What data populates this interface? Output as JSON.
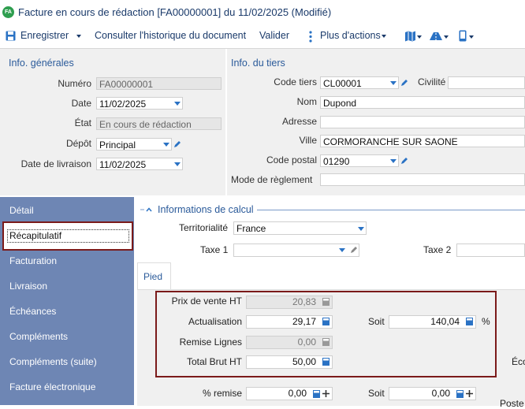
{
  "window": {
    "badge": "FA",
    "title": "Facture en cours de rédaction [FA00000001] du 11/02/2025 (Modifié)"
  },
  "toolbar": {
    "save_label": "Enregistrer",
    "history_label": "Consulter l'historique du document",
    "validate_label": "Valider",
    "more_actions_label": "Plus d'actions"
  },
  "general": {
    "section_title": "Info. générales",
    "numero_label": "Numéro",
    "numero_value": "FA00000001",
    "date_label": "Date",
    "date_value": "11/02/2025",
    "etat_label": "État",
    "etat_value": "En cours de rédaction",
    "depot_label": "Dépôt",
    "depot_value": "Principal",
    "livraison_label": "Date de livraison",
    "livraison_value": "11/02/2025"
  },
  "tiers": {
    "section_title": "Info. du tiers",
    "code_label": "Code tiers",
    "code_value": "CL00001",
    "civilite_label": "Civilité",
    "civilite_value": "",
    "nom_label": "Nom",
    "nom_value": "Dupond",
    "adresse_label": "Adresse",
    "adresse_value": "",
    "ville_label": "Ville",
    "ville_value": "CORMORANCHE SUR SAONE",
    "cp_label": "Code postal",
    "cp_value": "01290",
    "reglement_label": "Mode de règlement",
    "reglement_value": ""
  },
  "nav": {
    "items": [
      "Détail",
      "Récapitulatif",
      "Facturation",
      "Livraison",
      "Échéances",
      "Compléments",
      "Compléments (suite)",
      "Facture électronique"
    ],
    "selected": "Récapitulatif"
  },
  "calc": {
    "section_title": "Informations de calcul",
    "territorialite_label": "Territorialité",
    "territorialite_value": "France",
    "taxe1_label": "Taxe 1",
    "taxe1_value": "",
    "taxe2_label": "Taxe 2",
    "tab_pied": "Pied",
    "prix_label": "Prix de vente HT",
    "prix_value": "20,83",
    "actualisation_label": "Actualisation",
    "actualisation_value": "29,17",
    "soit_label": "Soit",
    "soit_value": "140,04",
    "pct": "%",
    "remise_lignes_label": "Remise Lignes",
    "remise_lignes_value": "0,00",
    "total_brut_label": "Total Brut HT",
    "total_brut_value": "50,00",
    "pct_remise_label": "% remise",
    "pct_remise_value": "0,00",
    "soit2_label": "Soit",
    "soit2_value": "0,00",
    "eco_label": "Éco",
    "poste_label": "Poste"
  },
  "colors": {
    "accent": "#2a72c4",
    "nav_bg": "#6e86b4",
    "highlight": "#7b1a1a",
    "brand": "#2e9e4f"
  }
}
